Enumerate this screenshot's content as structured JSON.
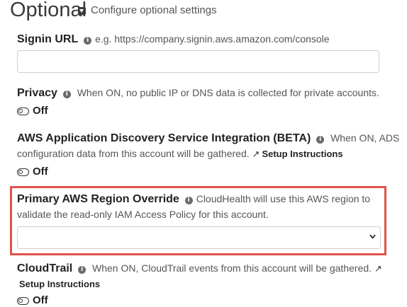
{
  "section": {
    "title": "Optional",
    "subtitle": "Configure optional settings"
  },
  "signin_url": {
    "label": "Signin URL",
    "hint": "e.g. https://company.signin.aws.amazon.com/console",
    "value": "",
    "placeholder": ""
  },
  "privacy": {
    "label": "Privacy",
    "hint": "When ON, no public IP or DNS data is collected for private accounts.",
    "state": "Off"
  },
  "ads": {
    "label": "AWS Application Discovery Service Integration (BETA)",
    "hint_line1": "When ON, ADS",
    "hint_line2": "configuration data from this account will be gathered.",
    "link": "Setup Instructions",
    "state": "Off"
  },
  "region_override": {
    "label": "Primary AWS Region Override",
    "hint_line1": "CloudHealth will use this AWS region to",
    "hint_line2": "validate the read-only IAM Access Policy for this account.",
    "selected": ""
  },
  "cloudtrail": {
    "label": "CloudTrail",
    "hint": "When ON, CloudTrail events from this account will be gathered.",
    "link": "Setup Instructions",
    "state": "Off"
  },
  "colors": {
    "highlight_border": "#e0524a",
    "text": "#333333"
  },
  "icons": [
    "caret-down-box-icon",
    "info-icon",
    "external-link-icon",
    "toggle-off-icon",
    "chevron-down-icon"
  ]
}
